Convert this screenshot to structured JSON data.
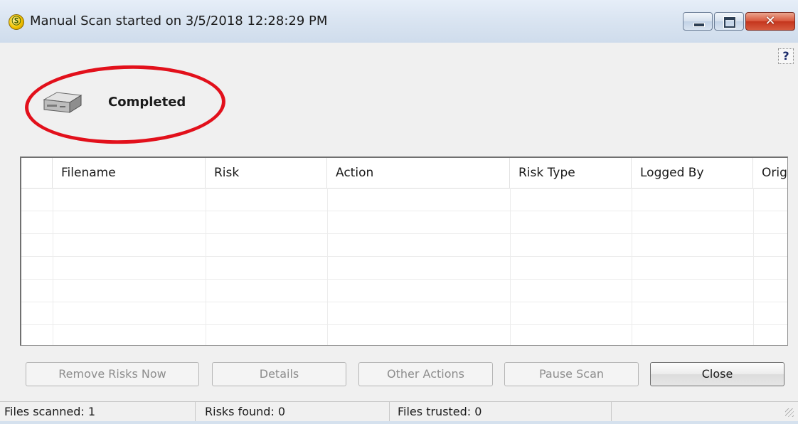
{
  "window": {
    "title": "Manual Scan started on 3/5/2018 12:28:29 PM",
    "app_icon_glyph": "Ⓢ",
    "close_glyph": "✕"
  },
  "help": {
    "glyph": "?"
  },
  "status": {
    "label": "Completed"
  },
  "table": {
    "columns": [
      "",
      "Filename",
      "Risk",
      "Action",
      "Risk Type",
      "Logged By",
      "Orig"
    ],
    "rows": []
  },
  "buttons": {
    "remove_risks": "Remove Risks Now",
    "details": "Details",
    "other_actions": "Other Actions",
    "pause_scan": "Pause Scan",
    "close": "Close"
  },
  "statusbar": {
    "files_scanned": "Files scanned: 1",
    "risks_found": "Risks found: 0",
    "files_trusted": "Files trusted: 0"
  },
  "colors": {
    "highlight_ellipse": "#e2101b",
    "titlebar": "#dbe6f3",
    "close_button": "#d9553a"
  },
  "icons": {
    "app": "shield-logo-icon",
    "status": "hard-drive-icon",
    "help": "help-icon"
  }
}
